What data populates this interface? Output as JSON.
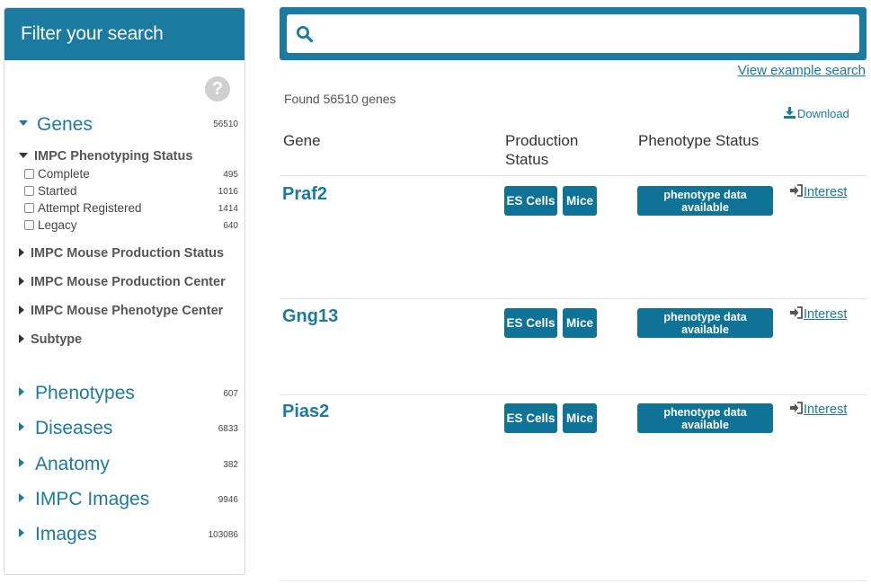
{
  "sidebar": {
    "title": "Filter your search",
    "genes": {
      "label": "Genes",
      "count": "56510"
    },
    "phenotyping_status": {
      "title": "IMPC Phenotyping Status",
      "options": [
        {
          "label": "Complete",
          "count": "495"
        },
        {
          "label": "Started",
          "count": "1016"
        },
        {
          "label": "Attempt Registered",
          "count": "1414"
        },
        {
          "label": "Legacy",
          "count": "640"
        }
      ]
    },
    "subfacets": [
      "IMPC Mouse Production Status",
      "IMPC Mouse Production Center",
      "IMPC Mouse Phenotype Center",
      "Subtype"
    ],
    "facets": [
      {
        "label": "Phenotypes",
        "count": "607"
      },
      {
        "label": "Diseases",
        "count": "6833"
      },
      {
        "label": "Anatomy",
        "count": "382"
      },
      {
        "label": "IMPC Images",
        "count": "9946"
      },
      {
        "label": "Images",
        "count": "103086"
      }
    ]
  },
  "search": {
    "value": "",
    "placeholder": "",
    "example_link": "View example search"
  },
  "results": {
    "found_text": "Found 56510 genes",
    "download_label": "Download",
    "columns": {
      "gene": "Gene",
      "production_line1": "Production",
      "production_line2": "Status",
      "phenotype": "Phenotype Status"
    },
    "rows": [
      {
        "gene": "Praf2",
        "es_cells": "ES Cells",
        "mice": "Mice",
        "phenotype_line1": "phenotype data",
        "phenotype_line2": "available",
        "interest": "Interest"
      },
      {
        "gene": "Gng13",
        "es_cells": "ES Cells",
        "mice": "Mice",
        "phenotype_line1": "phenotype data",
        "phenotype_line2": "available",
        "interest": "Interest"
      },
      {
        "gene": "Pias2",
        "es_cells": "ES Cells",
        "mice": "Mice",
        "phenotype_line1": "phenotype data",
        "phenotype_line2": "available",
        "interest": "Interest"
      }
    ]
  },
  "colors": {
    "accent": "#1b7aa0",
    "button": "#0e7396"
  },
  "icons": {
    "help": "question-circle-icon",
    "search": "magnifier-icon",
    "download": "download-icon",
    "interest": "sign-in-icon"
  }
}
